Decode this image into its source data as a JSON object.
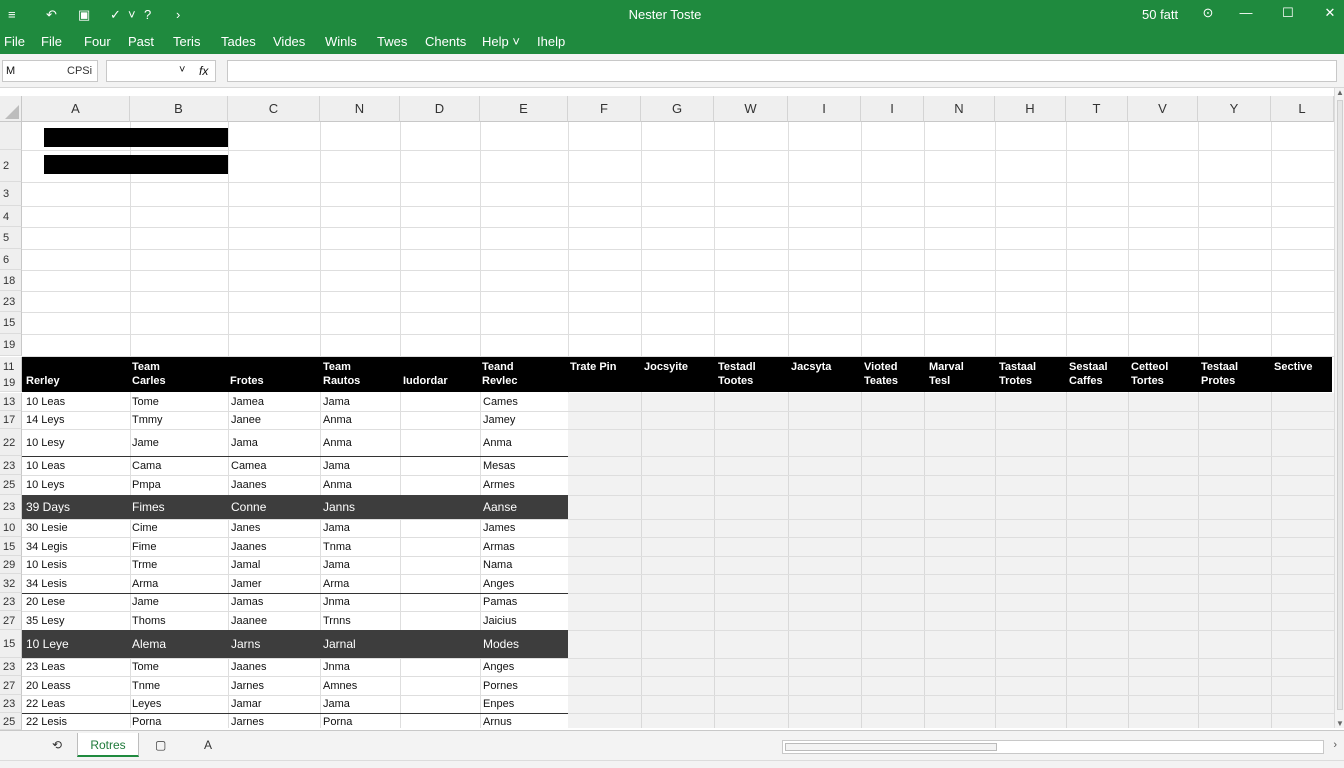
{
  "titlebar": {
    "quick_icons": [
      "≡",
      "↶",
      "▣",
      "✓",
      "˅",
      "?",
      "›"
    ],
    "title": "Nester Toste",
    "status": "50 fatt",
    "help_glyph": "⊙",
    "min_glyph": "—",
    "max_glyph": "☐",
    "close_glyph": "✕"
  },
  "menu": [
    "File",
    "File",
    "Four",
    "Past",
    "Teris",
    "Tades",
    "Vides",
    "Winls",
    "Twes",
    "Chents",
    "Help ˅",
    "Ihelp"
  ],
  "formula": {
    "cell_ref": "M",
    "cell_value": "CPSi",
    "dropdown_glyph": "˅",
    "fx_glyph": "fx"
  },
  "columns": [
    "A",
    "B",
    "C",
    "N",
    "D",
    "E",
    "F",
    "G",
    "W",
    "I",
    "I",
    "N",
    "H",
    "T",
    "V",
    "Y",
    "L"
  ],
  "top_rows": [
    "2",
    "3",
    "4",
    "5",
    "6",
    "18",
    "23",
    "15",
    "19"
  ],
  "header_row_nums": [
    "11",
    "19"
  ],
  "table_headers": [
    [
      "",
      "Rerley"
    ],
    [
      "Team",
      "Carles"
    ],
    [
      "",
      "Frotes"
    ],
    [
      "Team",
      "Rautos"
    ],
    [
      "",
      "Iudordar"
    ],
    [
      "Teand",
      "Revlec"
    ],
    [
      "Trate Pin",
      ""
    ],
    [
      "Jocsyite",
      ""
    ],
    [
      "Testadl",
      "Tootes"
    ],
    [
      "Jacsyta",
      ""
    ],
    [
      "Vioted",
      "Teates"
    ],
    [
      "Marval",
      "Tesl"
    ],
    [
      "Tastaal",
      "Trotes"
    ],
    [
      "Sestaal",
      "Caffes"
    ],
    [
      "Cetteol",
      "Tortes"
    ],
    [
      "Testaal",
      "Protes"
    ],
    [
      "Sective",
      ""
    ]
  ],
  "rows": [
    {
      "n": "13",
      "a": "10 Leas",
      "b": "Tome",
      "c": "Jamea",
      "n2": "Jama",
      "d": "",
      "e": "Cames",
      "dark": false
    },
    {
      "n": "17",
      "a": "14 Leys",
      "b": "Tmmy",
      "c": "Janee",
      "n2": "Anma",
      "d": "",
      "e": "Jamey",
      "dark": false
    },
    {
      "n": "22",
      "a": "10 Lesy",
      "b": "Jame",
      "c": "Jama",
      "n2": "Anma",
      "d": "",
      "e": "Anma",
      "dark": false
    },
    {
      "n": "23",
      "a": "10 Leas",
      "b": "Cama",
      "c": "Camea",
      "n2": "Jama",
      "d": "",
      "e": "Mesas",
      "dark": false
    },
    {
      "n": "25",
      "a": "10 Leys",
      "b": "Pmpa",
      "c": "Jaanes",
      "n2": "Anma",
      "d": "",
      "e": "Armes",
      "dark": false
    },
    {
      "n": "23",
      "a": "39 Days",
      "b": "Fimes",
      "c": "Conne",
      "n2": "Janns",
      "d": "",
      "e": "Aanse",
      "dark": true
    },
    {
      "n": "10",
      "a": "30 Lesie",
      "b": "Cime",
      "c": "Janes",
      "n2": "Jama",
      "d": "",
      "e": "James",
      "dark": false
    },
    {
      "n": "15",
      "a": "34 Legis",
      "b": "Fime",
      "c": "Jaanes",
      "n2": "Tnma",
      "d": "",
      "e": "Armas",
      "dark": false
    },
    {
      "n": "29",
      "a": "10 Lesis",
      "b": "Trme",
      "c": "Jamal",
      "n2": "Jama",
      "d": "",
      "e": "Nama",
      "dark": false
    },
    {
      "n": "32",
      "a": "34 Lesis",
      "b": "Arma",
      "c": "Jamer",
      "n2": "Arma",
      "d": "",
      "e": "Anges",
      "dark": false
    },
    {
      "n": "23",
      "a": "20 Lese",
      "b": "Jame",
      "c": "Jamas",
      "n2": "Jnma",
      "d": "",
      "e": "Pamas",
      "dark": false
    },
    {
      "n": "27",
      "a": "35 Lesy",
      "b": "Thoms",
      "c": "Jaanee",
      "n2": "Trnns",
      "d": "",
      "e": "Jaicius",
      "dark": false
    },
    {
      "n": "15",
      "a": "10 Leye",
      "b": "Alema",
      "c": "Jarns",
      "n2": "Jarnal",
      "d": "",
      "e": "Modes",
      "dark": true
    },
    {
      "n": "23",
      "a": "23 Leas",
      "b": "Tome",
      "c": "Jaanes",
      "n2": "Jnma",
      "d": "",
      "e": "Anges",
      "dark": false
    },
    {
      "n": "27",
      "a": "20 Leass",
      "b": "Tnme",
      "c": "Jarnes",
      "n2": "Amnes",
      "d": "",
      "e": "Pornes",
      "dark": false
    },
    {
      "n": "23",
      "a": "22 Leas",
      "b": "Leyes",
      "c": "Jamar",
      "n2": "Jama",
      "d": "",
      "e": "Enpes",
      "dark": false
    },
    {
      "n": "25",
      "a": "22 Lesis",
      "b": "Porna",
      "c": "Jarnes",
      "n2": "Porna",
      "d": "",
      "e": "Arnus",
      "dark": false
    }
  ],
  "sheetbar": {
    "nav_left": "⟲",
    "active_tab": "Rotres",
    "add_sheet": "▢",
    "nav_right": "A",
    "scroll_end": "›"
  },
  "scrollbar": {
    "up": "▲",
    "down": "▼"
  }
}
